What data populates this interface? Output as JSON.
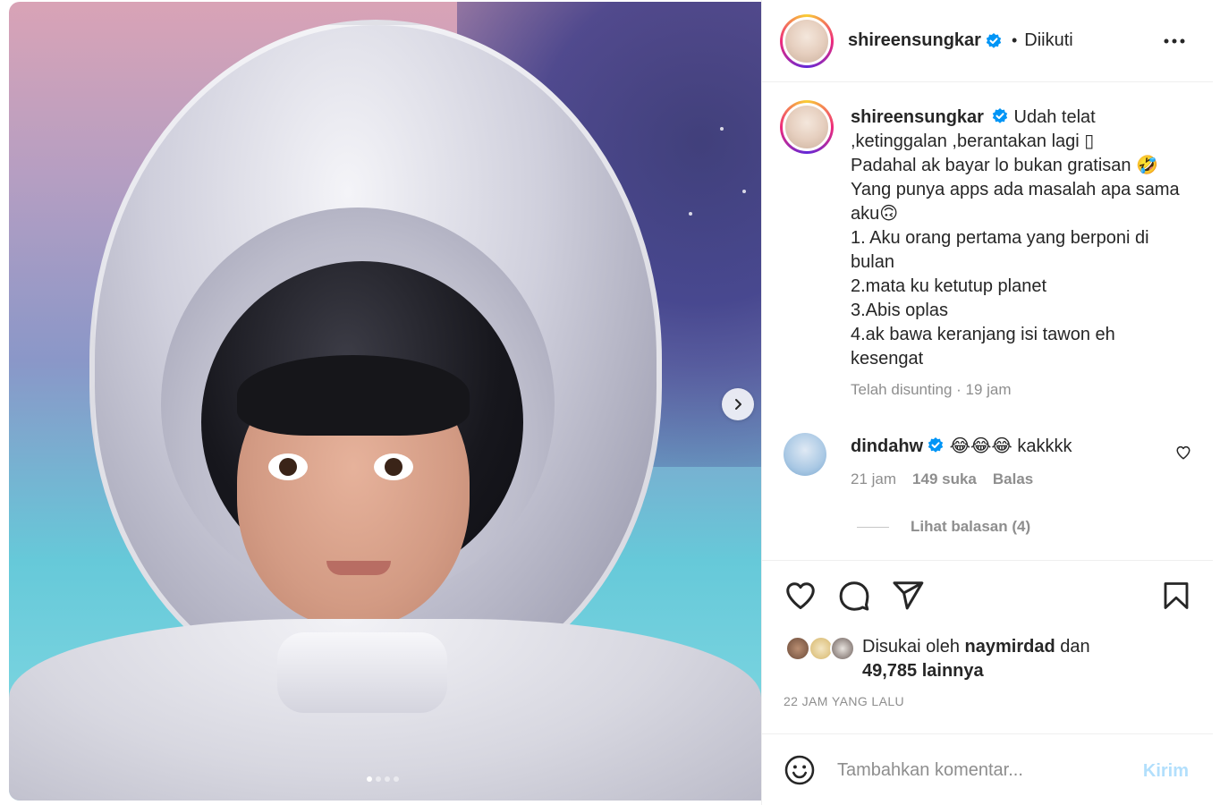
{
  "post": {
    "author": "shireensungkar",
    "follow_sep": "•",
    "follow_status": "Diikuti",
    "caption": "Udah telat ,ketinggalan ,berantakan lagi ▯\nPadahal ak bayar lo bukan gratisan 🤣\nYang punya apps ada masalah apa sama aku🙃\n1. Aku orang pertama yang berponi di bulan\n2.mata ku ketutup planet\n3.Abis oplas\n4.ak bawa keranjang isi tawon eh kesengat",
    "edited_meta": "Telah disunting · 19 jam",
    "carousel": {
      "pages": 4,
      "current": 1
    }
  },
  "comment": {
    "user": "dindahw",
    "text": "😂😂😂 kakkkk",
    "time": "21 jam",
    "likes": "149 suka",
    "reply_label": "Balas",
    "view_replies": "Lihat balasan (4)"
  },
  "likes": {
    "prefix": "Disukai oleh",
    "user": "naymirdad",
    "and": "dan",
    "others": "49,785 lainnya"
  },
  "timestamp": "22 JAM YANG LALU",
  "comment_box": {
    "placeholder": "Tambahkan komentar...",
    "post_label": "Kirim"
  },
  "icons": {
    "more": "more-icon",
    "verified": "verified-badge-icon",
    "like": "heart-icon",
    "comment": "comment-icon",
    "share": "share-icon",
    "save": "bookmark-icon",
    "emoji": "emoji-icon",
    "next": "chevron-right-icon"
  },
  "colors": {
    "verified": "#0095f6",
    "muted": "#8e8e8e",
    "post_disabled": "#b2dffc"
  }
}
